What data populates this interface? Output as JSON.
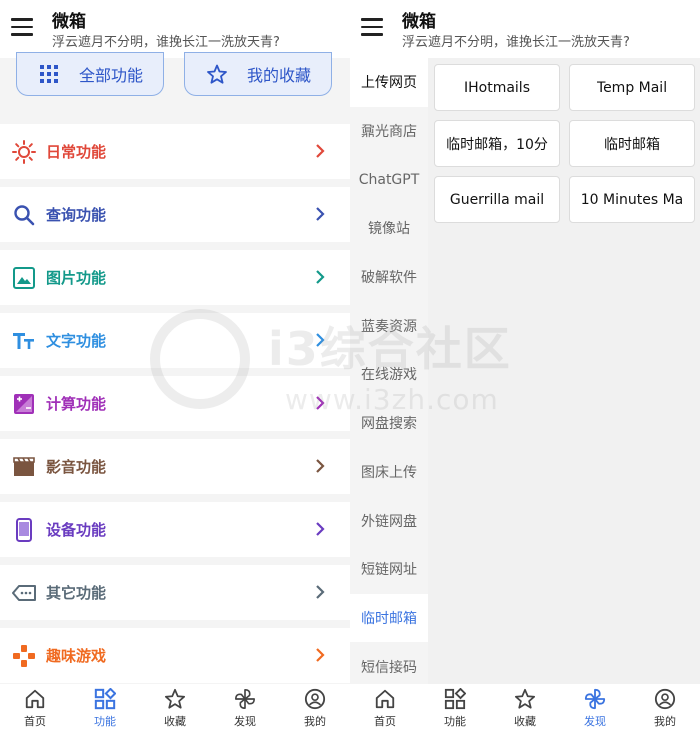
{
  "app": {
    "title": "微箱",
    "subtitle": "浮云遮月不分明，谁挽长江一洗放天青?"
  },
  "quick_buttons": {
    "all": "全部功能",
    "favorites": "我的收藏"
  },
  "categories": [
    {
      "label": "日常功能",
      "icon": "sun-icon",
      "color": "#e0483a"
    },
    {
      "label": "查询功能",
      "icon": "search-icon",
      "color": "#3a52b0"
    },
    {
      "label": "图片功能",
      "icon": "image-icon",
      "color": "#13998a"
    },
    {
      "label": "文字功能",
      "icon": "text-icon",
      "color": "#2f8fe0"
    },
    {
      "label": "计算功能",
      "icon": "calculator-icon",
      "color": "#a030b8"
    },
    {
      "label": "影音功能",
      "icon": "film-icon",
      "color": "#7a5540"
    },
    {
      "label": "设备功能",
      "icon": "phone-icon",
      "color": "#6a3cc0"
    },
    {
      "label": "其它功能",
      "icon": "tag-icon",
      "color": "#5a6b78"
    },
    {
      "label": "趣味游戏",
      "icon": "gamepad-icon",
      "color": "#f06a20"
    }
  ],
  "bottom_nav": {
    "items": [
      {
        "label": "首页",
        "icon": "home-icon"
      },
      {
        "label": "功能",
        "icon": "apps-icon"
      },
      {
        "label": "收藏",
        "icon": "star-icon"
      },
      {
        "label": "发现",
        "icon": "pinwheel-icon"
      },
      {
        "label": "我的",
        "icon": "profile-icon"
      }
    ],
    "left_active": "功能",
    "right_active": "发现"
  },
  "discover": {
    "sidebar": [
      "上传网页",
      "鼐光商店",
      "ChatGPT",
      "镜像站",
      "破解软件",
      "蓝奏资源",
      "在线游戏",
      "网盘搜索",
      "图床上传",
      "外链网盘",
      "短链网址",
      "临时邮箱",
      "短信接码"
    ],
    "selected": "临时邮箱",
    "chips": [
      "IHotmails",
      "Temp Mail",
      "临时邮箱，10分",
      "临时邮箱",
      "Guerrilla mail",
      "10 Minutes Ma"
    ]
  },
  "watermark": {
    "text": "i3综合社区",
    "url": "www.i3zh.com"
  },
  "colors": {
    "accent": "#3b74e0",
    "quick_button_bg": "#e8eefb"
  }
}
